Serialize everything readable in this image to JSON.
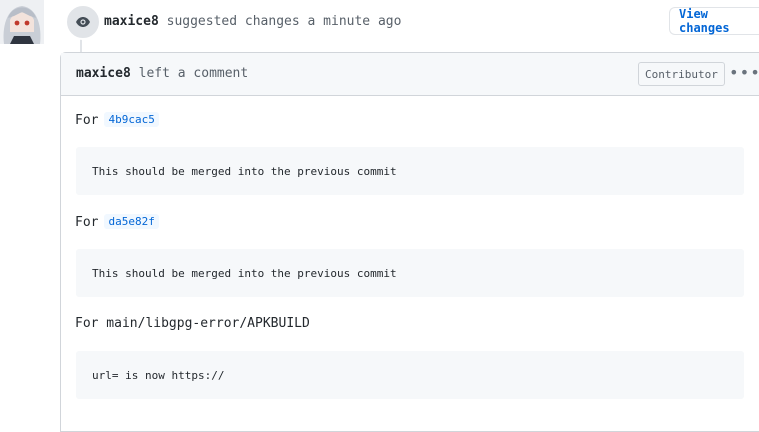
{
  "event": {
    "author": "maxice8",
    "action": "suggested changes",
    "time": "a minute ago",
    "view_changes_label": "View changes"
  },
  "comment": {
    "header": {
      "author": "maxice8",
      "action": "left a comment",
      "role": "Contributor"
    },
    "blocks": [
      {
        "prefix": "For",
        "sha": "4b9cac5",
        "code": "This should be merged into the previous commit"
      },
      {
        "prefix": "For",
        "sha": "da5e82f",
        "code": "This should be merged into the previous commit"
      }
    ],
    "file_line": "For main/libgpg-error/APKBUILD",
    "file_code": "url= is now https://"
  },
  "colors": {
    "link": "#0366d6",
    "header_bg": "#f6f8fa",
    "border": "#d1d5da"
  },
  "icons": {
    "event": "eye-icon",
    "menu": "kebab-horizontal-icon"
  }
}
